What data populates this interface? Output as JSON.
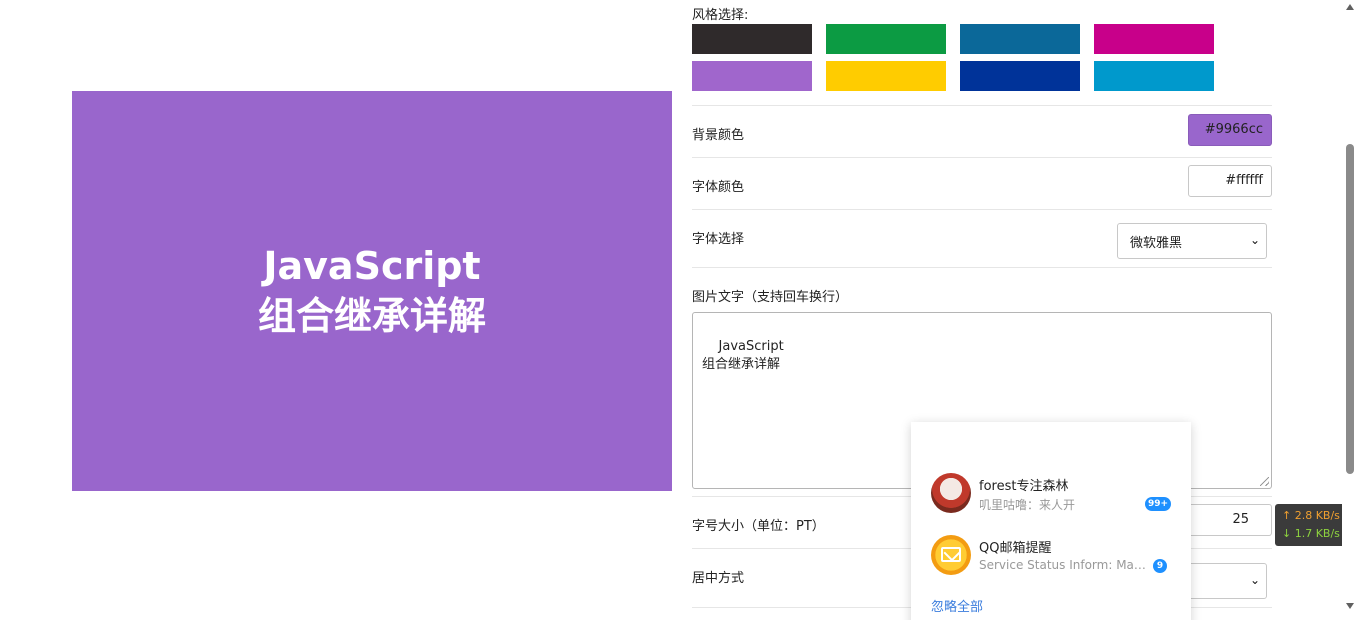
{
  "preview": {
    "lines": [
      "JavaScript",
      "组合继承详解"
    ],
    "background": "#9966cc",
    "text_color": "#ffffff"
  },
  "panel": {
    "style_label": "风格选择:",
    "swatches": [
      "#2f2a2b",
      "#0c9b43",
      "#0b6899",
      "#c8008a",
      "#a066cc",
      "#ffcc00",
      "#003399",
      "#0099cc"
    ],
    "bg_color_label": "背景颜色",
    "bg_color_value": "#9966cc",
    "font_color_label": "字体颜色",
    "font_color_value": "#ffffff",
    "font_select_label": "字体选择",
    "font_select_value": "微软雅黑",
    "text_label": "图片文字（支持回车换行）",
    "text_value": "JavaScript\n组合继承详解",
    "font_size_label": "字号大小（单位：PT）",
    "font_size_value": "25",
    "align_label": "居中方式"
  },
  "popup": {
    "messages": [
      {
        "title": "forest专注森林",
        "subtitle": "叽里咕噜：来人开",
        "badge": "99+"
      },
      {
        "title": "QQ邮箱提醒",
        "subtitle": "Service Status Inform: Main...",
        "badge": "9"
      }
    ],
    "ignore_all": "忽略全部"
  },
  "net_speed": {
    "up": "↑ 2.8 KB/s",
    "down": "↓ 1.7 KB/s"
  }
}
